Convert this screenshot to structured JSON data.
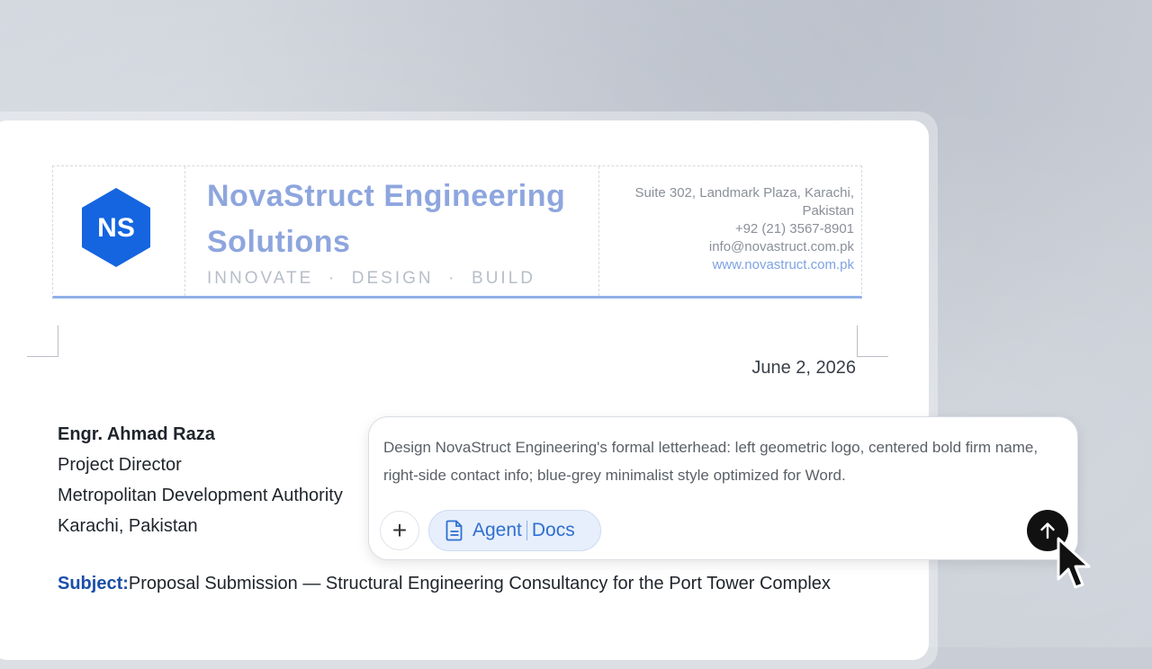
{
  "letterhead": {
    "logo_initials": "NS",
    "firm_name_line1": "NovaStruct Engineering",
    "firm_name_line2": "Solutions",
    "tagline": "INNOVATE  ·  DESIGN  ·  BUILD",
    "address_line1": "Suite 302, Landmark Plaza, Karachi,",
    "address_line2": "Pakistan",
    "phone": "+92 (21) 3567-8901",
    "email": "info@novastruct.com.pk",
    "website": "www.novastruct.com.pk"
  },
  "letter": {
    "date": "June 2, 2026",
    "recipient_name": "Engr. Ahmad Raza",
    "recipient_title": "Project Director",
    "recipient_org": "Metropolitan Development Authority",
    "recipient_city": "Karachi, Pakistan",
    "subject_label": "Subject:",
    "subject_text": "Proposal Submission — Structural Engineering Consultancy for the Port Tower Complex"
  },
  "prompt": {
    "text": "Design NovaStruct Engineering's formal letterhead: left geometric logo, centered bold firm name, right-side contact info; blue-grey minimalist style optimized for Word.",
    "plus_label": "+",
    "mode_left": "Agent",
    "mode_right": "Docs"
  },
  "icons": {
    "logo": "hexagon-logo-icon",
    "doc": "document-icon",
    "send": "arrow-up-icon",
    "cursor": "mouse-pointer-icon"
  },
  "colors": {
    "accent_blue": "#2f6fd0",
    "logo_blue": "#1565e0",
    "firm_name": "#8ea6de",
    "subject_label": "#1b4fa8"
  }
}
